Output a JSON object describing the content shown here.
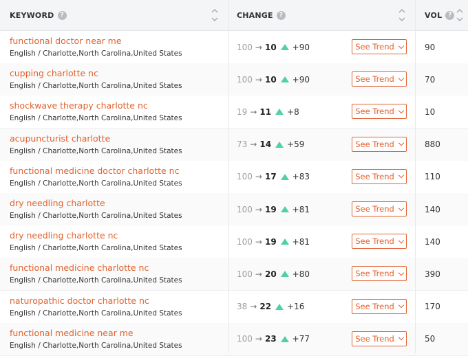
{
  "header": {
    "keyword": "KEYWORD",
    "change": "CHANGE",
    "vol": "VOL",
    "help_glyph": "?"
  },
  "trend_button_label": "See Trend",
  "arrow_glyph": "→",
  "colors": {
    "link": "#e0622f",
    "up_indicator": "#4fd1a3",
    "header_bg": "#f4f5f6"
  },
  "icons": {
    "help": "question-circle-icon",
    "sort": "sort-chevrons-icon",
    "change_up": "triangle-up-icon",
    "dropdown": "chevron-down-icon"
  },
  "rows": [
    {
      "keyword": "functional doctor near me",
      "location": "English / Charlotte,North Carolina,United States",
      "prev": "100",
      "current": "10",
      "delta": "+90",
      "volume": "90"
    },
    {
      "keyword": "cupping charlotte nc",
      "location": "English / Charlotte,North Carolina,United States",
      "prev": "100",
      "current": "10",
      "delta": "+90",
      "volume": "70"
    },
    {
      "keyword": "shockwave therapy charlotte nc",
      "location": "English / Charlotte,North Carolina,United States",
      "prev": "19",
      "current": "11",
      "delta": "+8",
      "volume": "10"
    },
    {
      "keyword": "acupuncturist charlotte",
      "location": "English / Charlotte,North Carolina,United States",
      "prev": "73",
      "current": "14",
      "delta": "+59",
      "volume": "880"
    },
    {
      "keyword": "functional medicine doctor charlotte nc",
      "location": "English / Charlotte,North Carolina,United States",
      "prev": "100",
      "current": "17",
      "delta": "+83",
      "volume": "110"
    },
    {
      "keyword": "dry needling charlotte",
      "location": "English / Charlotte,North Carolina,United States",
      "prev": "100",
      "current": "19",
      "delta": "+81",
      "volume": "140"
    },
    {
      "keyword": "dry needling charlotte nc",
      "location": "English / Charlotte,North Carolina,United States",
      "prev": "100",
      "current": "19",
      "delta": "+81",
      "volume": "140"
    },
    {
      "keyword": "functional medicine charlotte nc",
      "location": "English / Charlotte,North Carolina,United States",
      "prev": "100",
      "current": "20",
      "delta": "+80",
      "volume": "390"
    },
    {
      "keyword": "naturopathic doctor charlotte nc",
      "location": "English / Charlotte,North Carolina,United States",
      "prev": "38",
      "current": "22",
      "delta": "+16",
      "volume": "170"
    },
    {
      "keyword": "functional medicine near me",
      "location": "English / Charlotte,North Carolina,United States",
      "prev": "100",
      "current": "23",
      "delta": "+77",
      "volume": "50"
    }
  ]
}
